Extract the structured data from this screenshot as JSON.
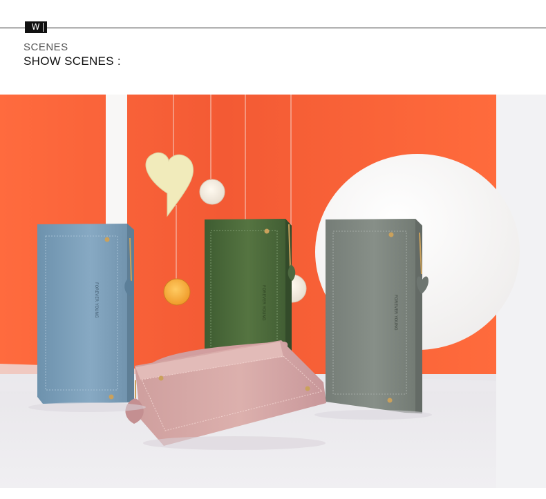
{
  "badge": {
    "letter": "W"
  },
  "header": {
    "eyebrow": "SCENES",
    "title": "SHOW SCENES :"
  },
  "photo": {
    "wallet_text": "FOREVER YOUNG",
    "colors": {
      "orange_wall": "#f2562f",
      "white_panel": "#f8f7f6",
      "floor": "#eceaf0",
      "blue_wallet": "#7a9fba",
      "green_wallet": "#4c6b3d",
      "gray_wallet": "#7f8781",
      "pink_wallet": "#d8aaa8",
      "gold": "#caa15c",
      "yarn_orange": "#f1a23d",
      "heart_cream": "#f1ebbb"
    }
  }
}
